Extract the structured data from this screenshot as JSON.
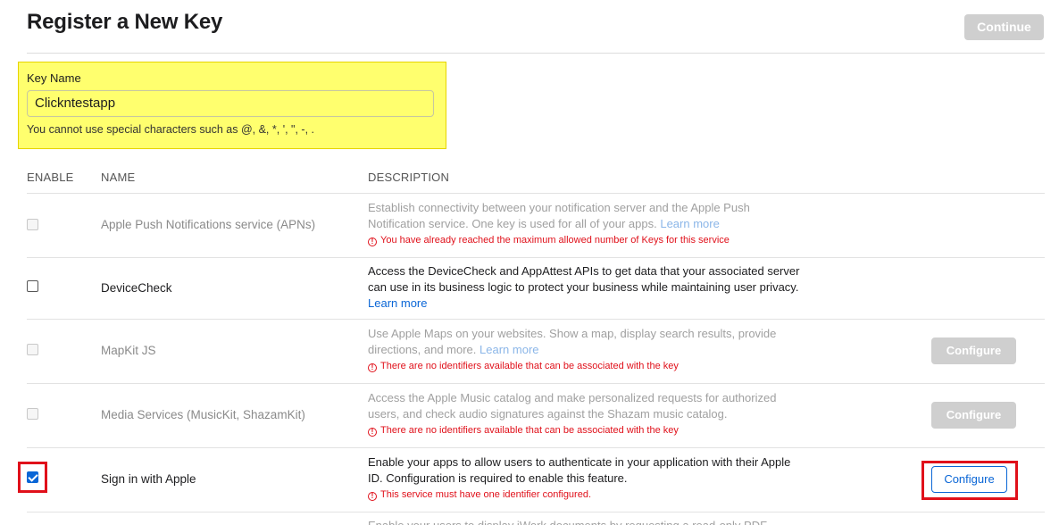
{
  "header": {
    "title": "Register a New Key",
    "continue_label": "Continue"
  },
  "key_name": {
    "label": "Key Name",
    "value": "Clickntestapp",
    "hint": "You cannot use special characters such as @, &, *, ', \", -, ."
  },
  "table": {
    "columns": [
      "ENABLE",
      "NAME",
      "DESCRIPTION"
    ],
    "rows": [
      {
        "name": "Apple Push Notifications service (APNs)",
        "enabled": false,
        "checked": false,
        "description": "Establish connectivity between your notification server and the Apple Push Notification service. One key is used for all of your apps.",
        "learn_more": "Learn more",
        "warning": "You have already reached the maximum allowed number of Keys for this service",
        "configure": ""
      },
      {
        "name": "DeviceCheck",
        "enabled": true,
        "checked": false,
        "description": "Access the DeviceCheck and AppAttest APIs to get data that your associated server can use in its business logic to protect your business while maintaining user privacy.",
        "learn_more": "Learn more",
        "warning": "",
        "configure": ""
      },
      {
        "name": "MapKit JS",
        "enabled": false,
        "checked": false,
        "description": "Use Apple Maps on your websites. Show a map, display search results, provide directions, and more.",
        "learn_more": "Learn more",
        "warning": "There are no identifiers available that can be associated with the key",
        "configure": "Configure"
      },
      {
        "name": "Media Services (MusicKit, ShazamKit)",
        "enabled": false,
        "checked": false,
        "description": "Access the Apple Music catalog and make personalized requests for authorized users, and check audio signatures against the Shazam music catalog.",
        "learn_more": "",
        "warning": "There are no identifiers available that can be associated with the key",
        "configure": "Configure"
      },
      {
        "name": "Sign in with Apple",
        "enabled": true,
        "checked": true,
        "description": "Enable your apps to allow users to authenticate in your application with their Apple ID. Configuration is required to enable this feature.",
        "learn_more": "",
        "warning": "This service must have one identifier configured.",
        "configure": "Configure"
      },
      {
        "partial_text": "Enable your users to display iWork documents by requesting a read-only PDF"
      }
    ]
  },
  "colors": {
    "accent": "#0a66d6",
    "error": "#e0101a",
    "highlight": "#ffff6e"
  }
}
